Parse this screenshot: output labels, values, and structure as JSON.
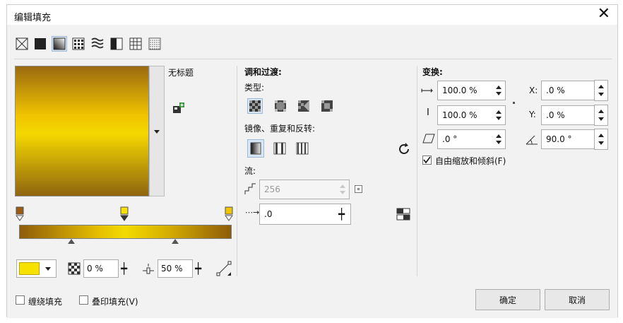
{
  "window": {
    "title": "编辑填充"
  },
  "preset": {
    "name": "无标题"
  },
  "color": {
    "swatch": "#f7e100",
    "stop_colors": [
      "#9b5c12",
      "#f7e100",
      "#f0c400"
    ]
  },
  "left_controls": {
    "transparency_value": "0 %",
    "position_value": "50 %"
  },
  "blend": {
    "heading": "调和过渡:",
    "type_label": "类型:",
    "mirror_label": "镜像、重复和反转:",
    "flow_label": "流:",
    "steps_value": "256",
    "acceleration_value": ".0"
  },
  "transform": {
    "heading": "变换:",
    "width_value": "100.0 %",
    "height_value": "100.0 %",
    "skew_value": ".0 °",
    "x_label": "X:",
    "x_value": ".0 %",
    "y_label": "Y:",
    "y_value": ".0 %",
    "rotate_value": "90.0 °",
    "free_scale_label": "自由缩放和倾斜(F)",
    "free_scale_checked": true
  },
  "bottom": {
    "wrap_fill_label": "缠绕填充",
    "overprint_label": "叠印填充(V)",
    "ok_label": "确定",
    "cancel_label": "取消"
  }
}
